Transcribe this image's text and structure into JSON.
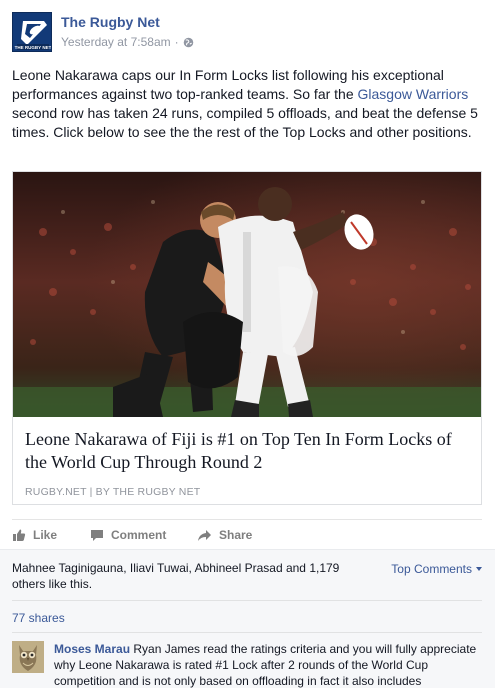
{
  "post": {
    "page_name": "The Rugby Net",
    "timestamp": "Yesterday at 7:58am",
    "separator": "·",
    "avatar_text": "THE RUGBY NET",
    "text_before_link": "Leone Nakarawa caps our In Form Locks list following his exceptional performances against two top-ranked teams. So far the ",
    "text_link": "Glasgow Warriors",
    "text_after_link": " second row has taken 24 runs, compiled 5 offloads, and beat the defense 5 times. Click below to see the the rest of the Top Locks and other positions."
  },
  "link_card": {
    "title": "Leone Nakarawa of Fiji is #1 on Top Ten In Form Locks of the World Cup Through Round 2",
    "source": "RUGBY.NET | BY THE RUGBY NET"
  },
  "actions": {
    "like": "Like",
    "comment": "Comment",
    "share": "Share"
  },
  "ufi": {
    "likes_text": "Mahnee Taginigauna, Iliavi Tuwai, Abhineel Prasad and 1,179 others like this.",
    "top_comments_label": "Top Comments",
    "shares": "77 shares"
  },
  "comment": {
    "author": "Moses Marau",
    "text": " Ryan James read the ratings criteria and you will fully appreciate why Leone Nakarawa is rated #1 Lock after 2 rounds of the World Cup competition and is not only based on offloading in fact it also includes"
  },
  "colors": {
    "link": "#3b5998",
    "meta": "#9197a3",
    "action": "#7f7f7f",
    "ufi_bg": "#f6f7f9"
  }
}
